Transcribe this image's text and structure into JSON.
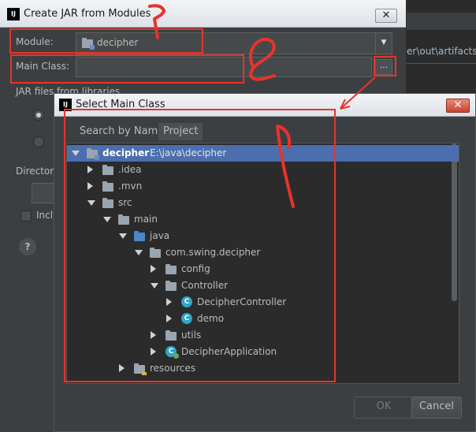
{
  "background_ide": {
    "path_fragment": "er\\out\\artifacts\\"
  },
  "outer_dialog": {
    "title": "Create JAR from Modules",
    "logo": "IJ",
    "close_glyph": "✕",
    "module_label": "Module:",
    "module_value": "decipher",
    "main_class_label": "Main Class:",
    "main_class_value": "",
    "browse_label": "...",
    "jar_files_label": "JAR files from libraries",
    "directory_label": "Director",
    "include_label": "Incl",
    "help_label": "?"
  },
  "select_dialog": {
    "title": "Select Main Class",
    "logo": "IJ",
    "close_glyph": "✕",
    "tabs": [
      {
        "label": "Search by Name",
        "selected": false
      },
      {
        "label": "Project",
        "selected": true
      }
    ],
    "tree": [
      {
        "label": "decipher",
        "hint": "E:\\java\\decipher",
        "depth": 0,
        "expanded": true,
        "icon": "module-folder-icon",
        "selected": true
      },
      {
        "label": ".idea",
        "depth": 1,
        "expanded": false,
        "icon": "folder-icon"
      },
      {
        "label": ".mvn",
        "depth": 1,
        "expanded": false,
        "icon": "folder-icon"
      },
      {
        "label": "src",
        "depth": 1,
        "expanded": true,
        "icon": "folder-icon"
      },
      {
        "label": "main",
        "depth": 2,
        "expanded": true,
        "icon": "folder-icon"
      },
      {
        "label": "java",
        "depth": 3,
        "expanded": true,
        "icon": "source-folder-icon"
      },
      {
        "label": "com.swing.decipher",
        "depth": 4,
        "expanded": true,
        "icon": "package-icon"
      },
      {
        "label": "config",
        "depth": 5,
        "expanded": false,
        "icon": "package-icon"
      },
      {
        "label": "Controller",
        "depth": 5,
        "expanded": true,
        "icon": "package-icon"
      },
      {
        "label": "DecipherController",
        "depth": 6,
        "expanded": false,
        "icon": "class-icon"
      },
      {
        "label": "demo",
        "depth": 6,
        "expanded": false,
        "icon": "class-icon"
      },
      {
        "label": "utils",
        "depth": 5,
        "expanded": false,
        "icon": "package-icon"
      },
      {
        "label": "DecipherApplication",
        "depth": 5,
        "expanded": false,
        "icon": "spring-class-icon"
      },
      {
        "label": "resources",
        "depth": 3,
        "expanded": false,
        "icon": "resources-folder-icon"
      }
    ],
    "ok_label": "OK",
    "cancel_label": "Cancel"
  },
  "colors": {
    "annotation_red": "#e8332b",
    "selection_blue": "#4b6eaf",
    "dialog_bg": "#3c3f41",
    "tree_bg": "#2b2b2b"
  }
}
